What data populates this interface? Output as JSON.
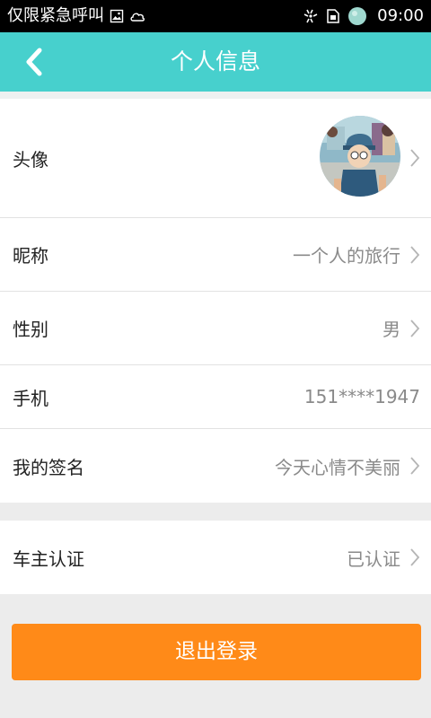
{
  "status_bar": {
    "carrier": "仅限紧急呼叫",
    "time": "09:00",
    "icons": [
      "image-icon",
      "cloud-icon",
      "data-sync-icon",
      "sim-card-icon",
      "battery-icon"
    ]
  },
  "header": {
    "title": "个人信息",
    "back_icon": "chevron-left-icon"
  },
  "colors": {
    "header_bg": "#47d0cd",
    "logout_bg": "#ff8a18"
  },
  "profile": {
    "avatar": {
      "label": "头像"
    },
    "nickname": {
      "label": "昵称",
      "value": "一个人的旅行"
    },
    "gender": {
      "label": "性别",
      "value": "男"
    },
    "phone": {
      "label": "手机",
      "value": "151****1947"
    },
    "signature": {
      "label": "我的签名",
      "value": "今天心情不美丽"
    }
  },
  "verification": {
    "car_owner": {
      "label": "车主认证",
      "value": "已认证"
    }
  },
  "logout_label": "退出登录"
}
